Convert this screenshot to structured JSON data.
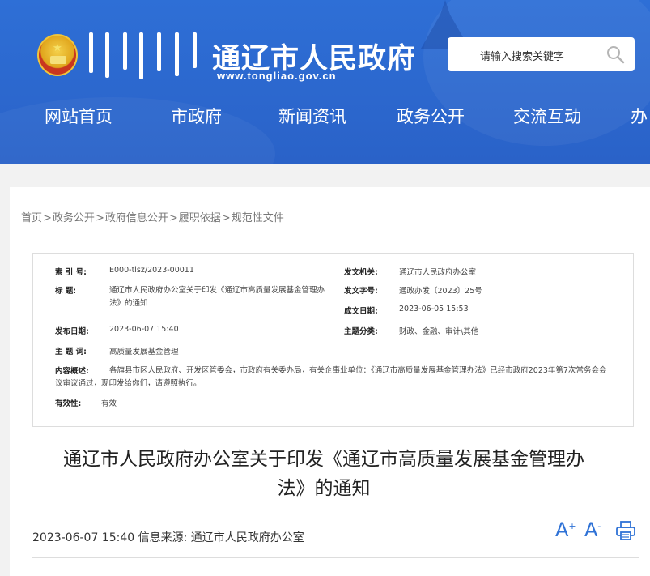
{
  "header": {
    "title": "通辽市人民政府",
    "url": "www.tongliao.gov.cn",
    "search_placeholder": "请输入搜索关键字"
  },
  "nav": {
    "items": [
      {
        "label": "网站首页"
      },
      {
        "label": "市政府"
      },
      {
        "label": "新闻资讯"
      },
      {
        "label": "政务公开"
      },
      {
        "label": "交流互动"
      },
      {
        "label": "办"
      }
    ]
  },
  "breadcrumb": {
    "items": [
      "首页",
      "政务公开",
      "政府信息公开",
      "履职依据",
      "规范性文件"
    ],
    "separator": ">"
  },
  "info": {
    "index_label": "索  引  号:",
    "index_value": "E000-tlsz/2023-00011",
    "title_label": "标      题:",
    "title_value": "通辽市人民政府办公室关于印发《通辽市高质量发展基金管理办法》的通知",
    "pubdate_label": "发布日期:",
    "pubdate_value": "2023-06-07 15:40",
    "keyword_label": "主  题  词:",
    "keyword_value": "高质量发展基金管理",
    "summary_label": "内容概述:",
    "summary_value": "各旗县市区人民政府、开发区管委会，市政府有关委办局，有关企事业单位：《通辽市高质量发展基金管理办法》已经市政府2023年第7次常务会会议审议通过，现印发给你们，请遵照执行。",
    "validity_label": "有效性:",
    "validity_value": "有效",
    "issuer_label": "发文机关:",
    "issuer_value": "通辽市人民政府办公室",
    "docno_label": "发文字号:",
    "docno_value": "通政办发〔2023〕25号",
    "date_label": "成文日期:",
    "date_value": "2023-06-05 15:53",
    "topic_label": "主题分类:",
    "topic_value": "财政、金融、审计\\其他"
  },
  "document": {
    "title_line1": "通辽市人民政府办公室关于印发《通辽市高质量发展基金管理办",
    "title_line2": "法》的通知",
    "meta": "2023-06-07 15:40 信息来源:  通辽市人民政府办公室"
  },
  "tools": {
    "font_up": "A",
    "font_up_sup": "+",
    "font_down": "A",
    "font_down_sup": "-"
  },
  "colors": {
    "header_bg": "#2e6fd6",
    "accent": "#2f72d6"
  }
}
